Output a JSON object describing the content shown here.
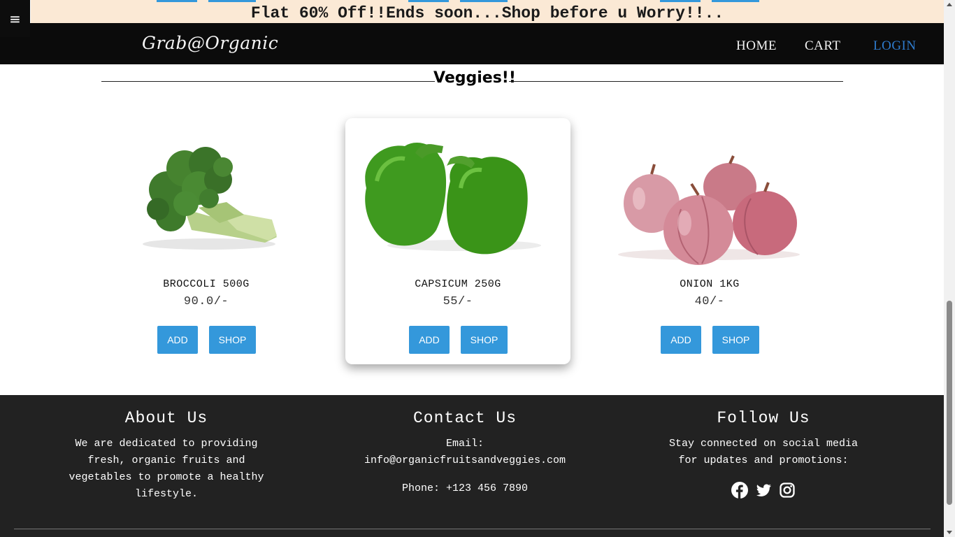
{
  "promo": {
    "text": "Flat 60% Off!!Ends soon...Shop before u Worry!!.."
  },
  "menu": {
    "icon": "hamburger-menu-icon",
    "glyph": "≡"
  },
  "nav": {
    "logo": "Grab@Organic",
    "links": [
      "HOME",
      "CART",
      "LOGIN"
    ],
    "active_color": "#2e7bcc"
  },
  "section": {
    "title": "Veggies!!"
  },
  "products": [
    {
      "name": "BROCCOLI 500G",
      "price": "90.0/-",
      "add_label": "ADD",
      "shop_label": "SHOP",
      "image": "broccoli"
    },
    {
      "name": "CAPSICUM 250G",
      "price": "55/-",
      "add_label": "ADD",
      "shop_label": "SHOP",
      "image": "green-capsicum"
    },
    {
      "name": "ONION 1KG",
      "price": "40/-",
      "add_label": "ADD",
      "shop_label": "SHOP",
      "image": "red-onions"
    }
  ],
  "footer": {
    "about": {
      "title": "About Us",
      "text_lines": [
        "We are dedicated to providing",
        "fresh, organic fruits and",
        "vegetables to promote a healthy",
        "lifestyle."
      ]
    },
    "contact": {
      "title": "Contact Us",
      "email_label": "Email:",
      "email": "info@organicfruitsandveggies.com",
      "phone": "Phone: +123 456 7890"
    },
    "follow": {
      "title": "Follow Us",
      "text_lines": [
        "Stay connected on social media",
        "for updates and promotions:"
      ],
      "icons": [
        "facebook-icon",
        "twitter-icon",
        "instagram-icon"
      ]
    }
  },
  "colors": {
    "accent": "#3498db",
    "footer_bg": "#222222",
    "nav_bg": "#0b0b0b",
    "promo_bg": "#fbe9d5"
  }
}
